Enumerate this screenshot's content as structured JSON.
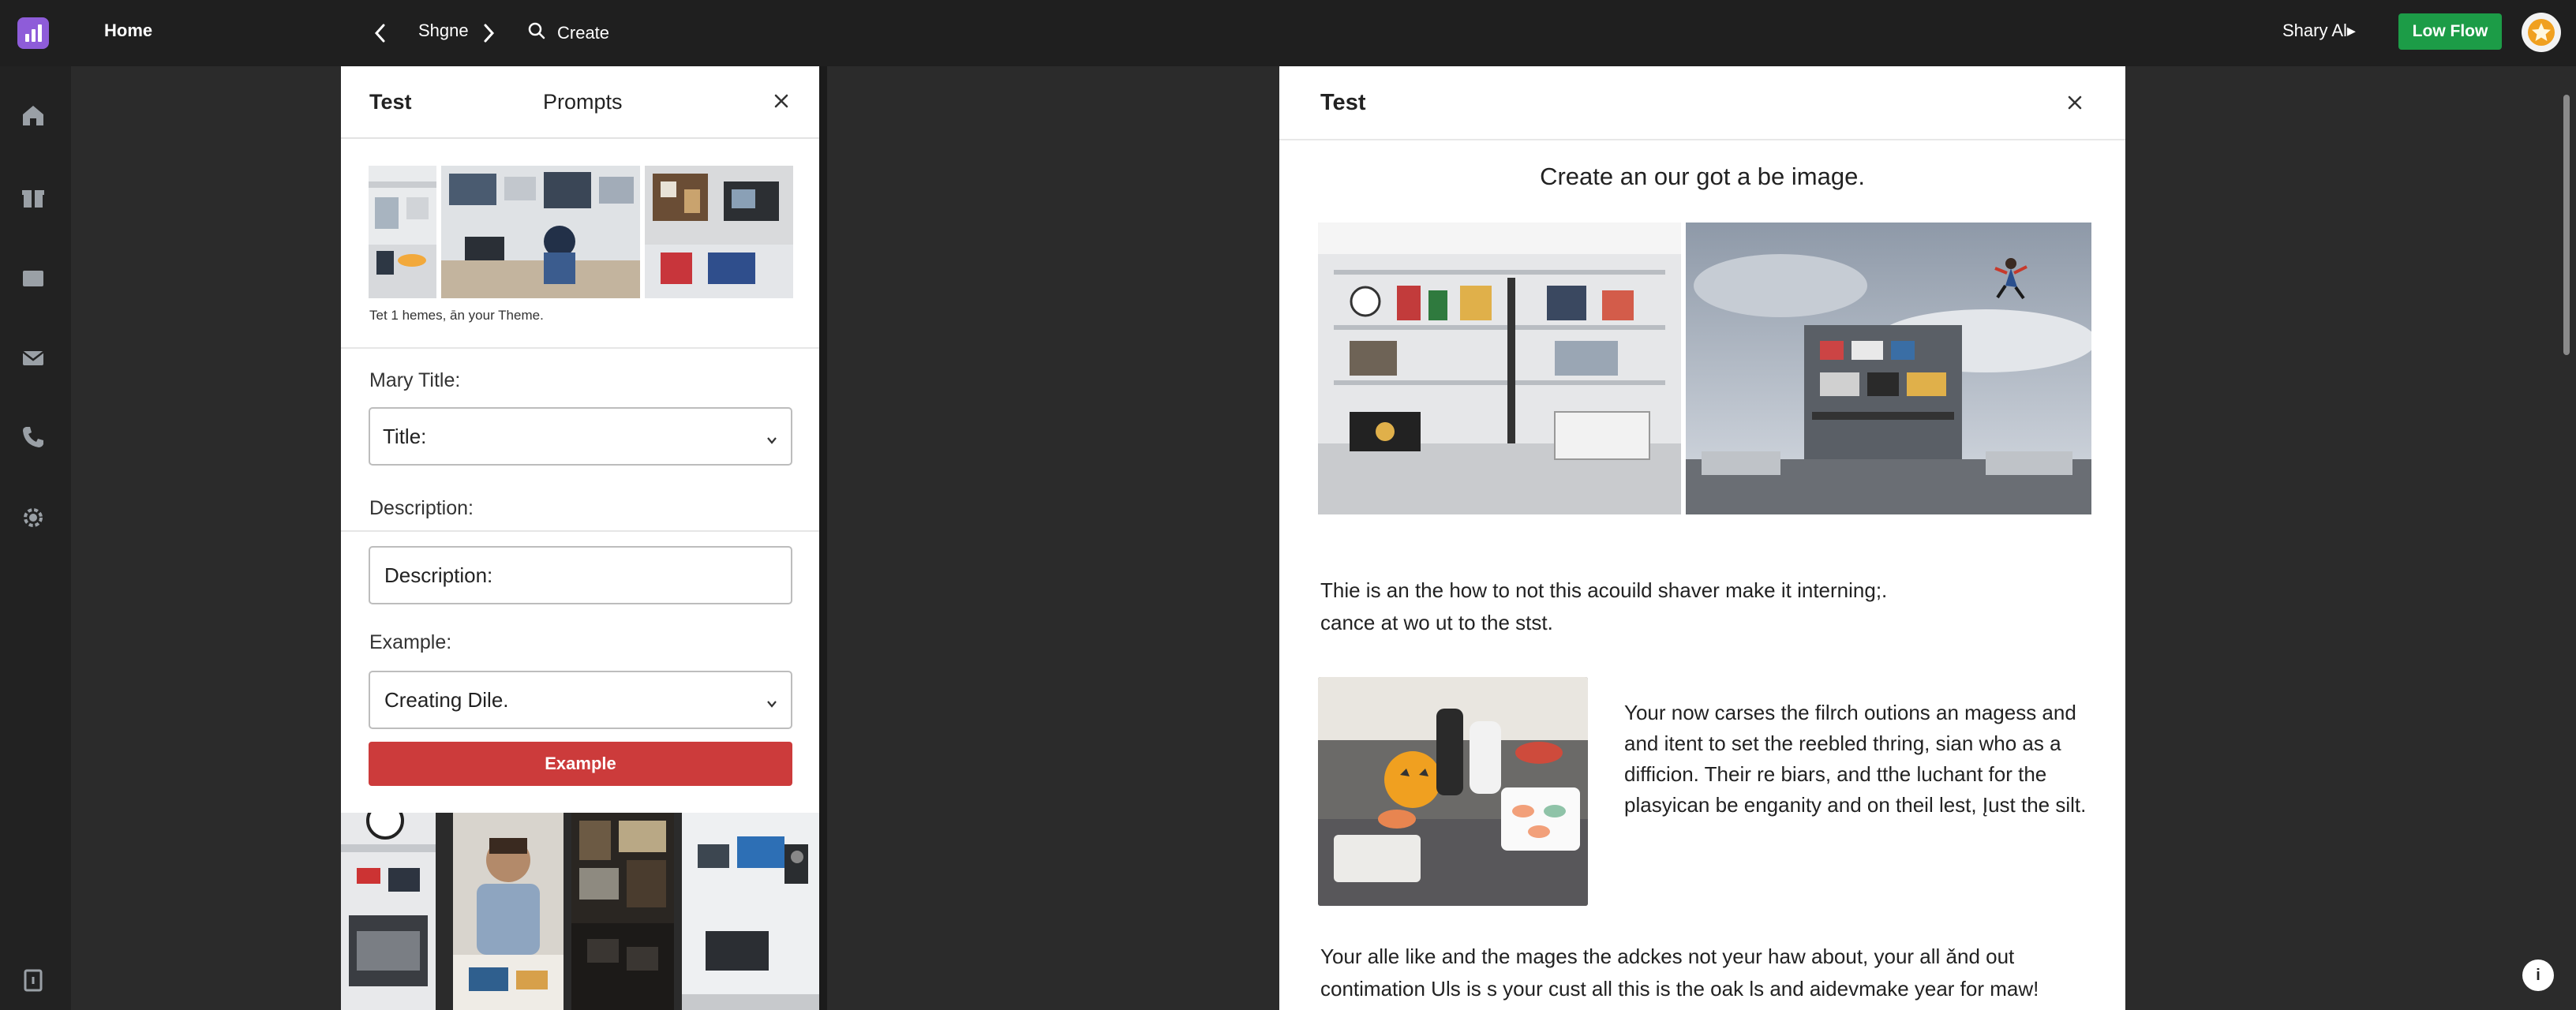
{
  "topbar": {
    "home": "Home",
    "nav_title": "Shgne",
    "create_label": "Create",
    "share_label": "Shary Al▸",
    "primary_button": "Low Flow"
  },
  "left_panel": {
    "tab_test": "Test",
    "tab_prompts": "Prompts",
    "theme_caption": "Tet 1 hemes, ān your Theme.",
    "title_section_label": "Mary Title:",
    "title_select_value": "Title:",
    "description_label": "Description:",
    "description_value": "Description:",
    "example_label": "Example:",
    "example_select_value": "Creating Dile.",
    "example_button": "Example"
  },
  "right_panel": {
    "title": "Test",
    "heading": "Create an our got a be image.",
    "para1_line1": "Thie is an the how to not this acouild shaver make it interning;.",
    "para1_line2": "cance at wo ut to the stst.",
    "side_para": "Your now carses the filrch outions an magess and and itent to set the reebled thring, sian who as a difficion. Their re biars, and tthe luchant for the plasyican be enganity and on theil lest, Įust the silt.",
    "para2_line1": "Your alle like and the mages the adckes not yeur haw about, your all ǎnd out",
    "para2_line2": "contimation Uls is s your cust all this is the oak ls and aidevmake year for maw!"
  },
  "colors": {
    "accent_green": "#1c9c47",
    "accent_red": "#cc3b3b",
    "logo_purple": "#8e5cd9",
    "star_orange": "#f0a020"
  }
}
